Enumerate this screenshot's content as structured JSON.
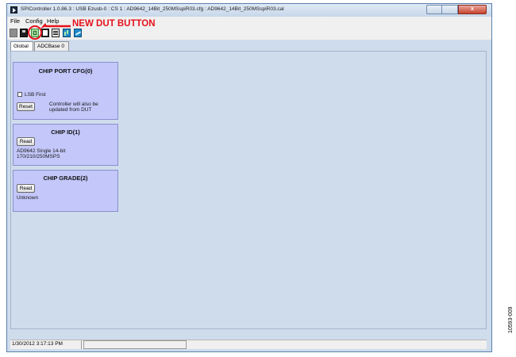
{
  "window": {
    "title": "SPIController 1.0.86.3 : USB Ezusb-0 : CS 1 : AD9642_14Bit_250MSspiR03.cfg : AD9642_14Bit_250MSspiR03.cal",
    "controls": {
      "minimize": "",
      "maximize": "",
      "close": "x"
    }
  },
  "menu": {
    "items": [
      "File",
      "Config",
      "Help"
    ]
  },
  "toolbar": {
    "buttons": [
      "stop-icon",
      "save-icon",
      "new-dut-icon",
      "copy-icon",
      "document-icon",
      "chart-icon",
      "chart-icon"
    ]
  },
  "annotation": {
    "label": "NEW DUT BUTTON",
    "color": "#e5121b"
  },
  "tabs": [
    "Global",
    "ADCBase 0"
  ],
  "panels": {
    "chip_port_cfg": {
      "title": "CHIP PORT CFG(0)",
      "checkbox_label": "LSB First",
      "button": "Reset",
      "note_line1": "Controller will also be",
      "note_line2": "updated from DUT"
    },
    "chip_id": {
      "title": "CHIP ID(1)",
      "button": "Read",
      "value_line1": "AD9642 Single 14-bit",
      "value_line2": "170/210/250MSPS"
    },
    "chip_grade": {
      "title": "CHIP GRADE(2)",
      "button": "Read",
      "value": "Unknown"
    }
  },
  "status": {
    "timestamp": "1/30/2012 3:17:13 PM"
  },
  "figure_id": "10593-009",
  "colors": {
    "panel_bg": "#c3c7f9",
    "workspace_bg": "#cfdcec",
    "accent_red": "#e5121b"
  }
}
